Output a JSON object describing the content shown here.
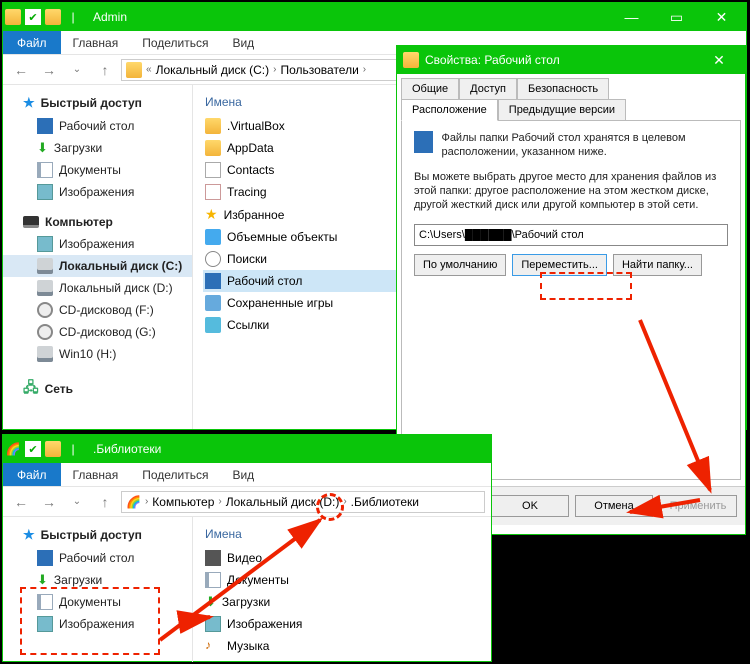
{
  "win1": {
    "title": "Admin",
    "menu": {
      "file": "Файл",
      "home": "Главная",
      "share": "Поделиться",
      "view": "Вид"
    },
    "bread": {
      "seg1": "Локальный диск (C:)",
      "seg2": "Пользователи"
    },
    "nav": {
      "quick": "Быстрый доступ",
      "desktop": "Рабочий стол",
      "downloads": "Загрузки",
      "documents": "Документы",
      "pictures": "Изображения",
      "computer": "Компьютер",
      "pictures2": "Изображения",
      "driveC": "Локальный диск (C:)",
      "driveD": "Локальный диск (D:)",
      "cdF": "CD-дисковод (F:)",
      "cdG": "CD-дисковод (G:)",
      "winH": "Win10 (H:)",
      "network": "Сеть"
    },
    "content": {
      "header": "Имена",
      "items": {
        "vbox": ".VirtualBox",
        "appdata": "AppData",
        "contacts": "Contacts",
        "tracing": "Tracing",
        "fav": "Избранное",
        "vol": "Объемные объекты",
        "search": "Поиски",
        "desktop": "Рабочий стол",
        "saved": "Сохраненные игры",
        "links": "Ссылки"
      }
    }
  },
  "win2": {
    "title": ".Библиотеки",
    "menu": {
      "file": "Файл",
      "home": "Главная",
      "share": "Поделиться",
      "view": "Вид"
    },
    "bread": {
      "seg1": "Компьютер",
      "seg2": "Локальный диск (D:)",
      "seg3": ".Библиотеки"
    },
    "nav": {
      "quick": "Быстрый доступ",
      "desktop": "Рабочий стол",
      "downloads": "Загрузки",
      "documents": "Документы",
      "pictures": "Изображения"
    },
    "content": {
      "header": "Имена",
      "items": {
        "video": "Видео",
        "documents": "Документы",
        "downloads": "Загрузки",
        "pictures": "Изображения",
        "music": "Музыка"
      }
    }
  },
  "dlg": {
    "title": "Свойства: Рабочий стол",
    "tabs": {
      "general": "Общие",
      "access": "Доступ",
      "security": "Безопасность",
      "location": "Расположение",
      "prev": "Предыдущие версии"
    },
    "body": {
      "line1": "Файлы папки Рабочий стол хранятся в целевом расположении, указанном ниже.",
      "line2": "Вы можете выбрать другое место для хранения файлов из этой папки: другое расположение на этом жестком диске, другой жесткий диск или другой компьютер в этой сети.",
      "path": "C:\\Users\\██████\\Рабочий стол",
      "btn_default": "По умолчанию",
      "btn_move": "Переместить...",
      "btn_find": "Найти папку..."
    },
    "foot": {
      "ok": "OK",
      "cancel": "Отмена",
      "apply": "Применить"
    }
  }
}
